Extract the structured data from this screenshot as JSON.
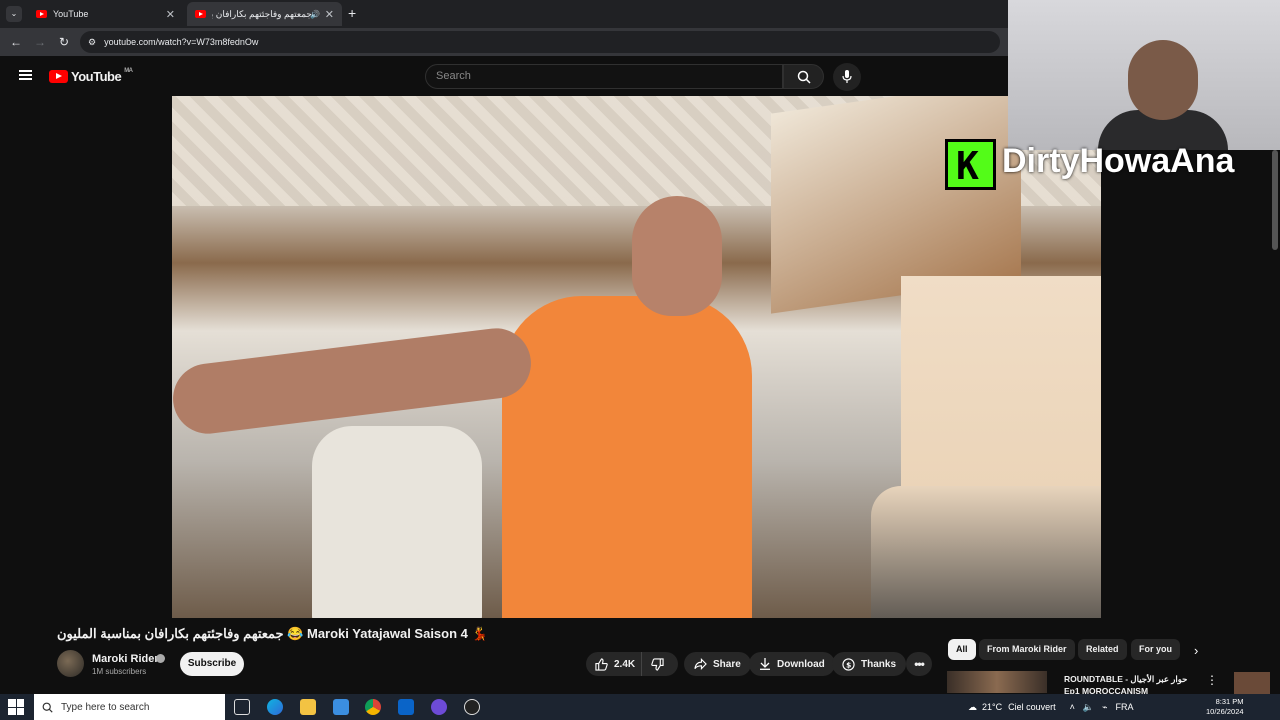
{
  "browser": {
    "tabs": [
      {
        "label": "YouTube"
      },
      {
        "label": "جمعتهم وفاجئتهم بكارافان بمـ"
      }
    ],
    "url": "youtube.com/watch?v=W73m8fednOw"
  },
  "youtube": {
    "logo_text": "YouTube",
    "region": "MA",
    "search_placeholder": "Search"
  },
  "overlay": {
    "streamer_name": "DirtyHowaAna",
    "platform_logo_letter": "K"
  },
  "video": {
    "title": "جمعتهم وفاجئتهم بكارافان بمناسبة المليون 😂 Maroki Yatajawal Saison 4 💃",
    "channel": "Maroki Rider",
    "subscribers": "1M subscribers",
    "subscribe_label": "Subscribe",
    "likes": "2.4K",
    "share_label": "Share",
    "download_label": "Download",
    "thanks_label": "Thanks"
  },
  "chips": [
    "All",
    "From Maroki Rider",
    "Related",
    "For you"
  ],
  "recommendation": {
    "title": "ROUNDTABLE - حوار عبر الأجيال",
    "title_line2": "Ep1 MOROCCANISM"
  },
  "taskbar": {
    "search_placeholder": "Type here to search",
    "weather_temp": "21°C",
    "weather_desc": "Ciel couvert",
    "language": "FRA",
    "time": "8:31 PM",
    "date": "10/26/2024"
  }
}
